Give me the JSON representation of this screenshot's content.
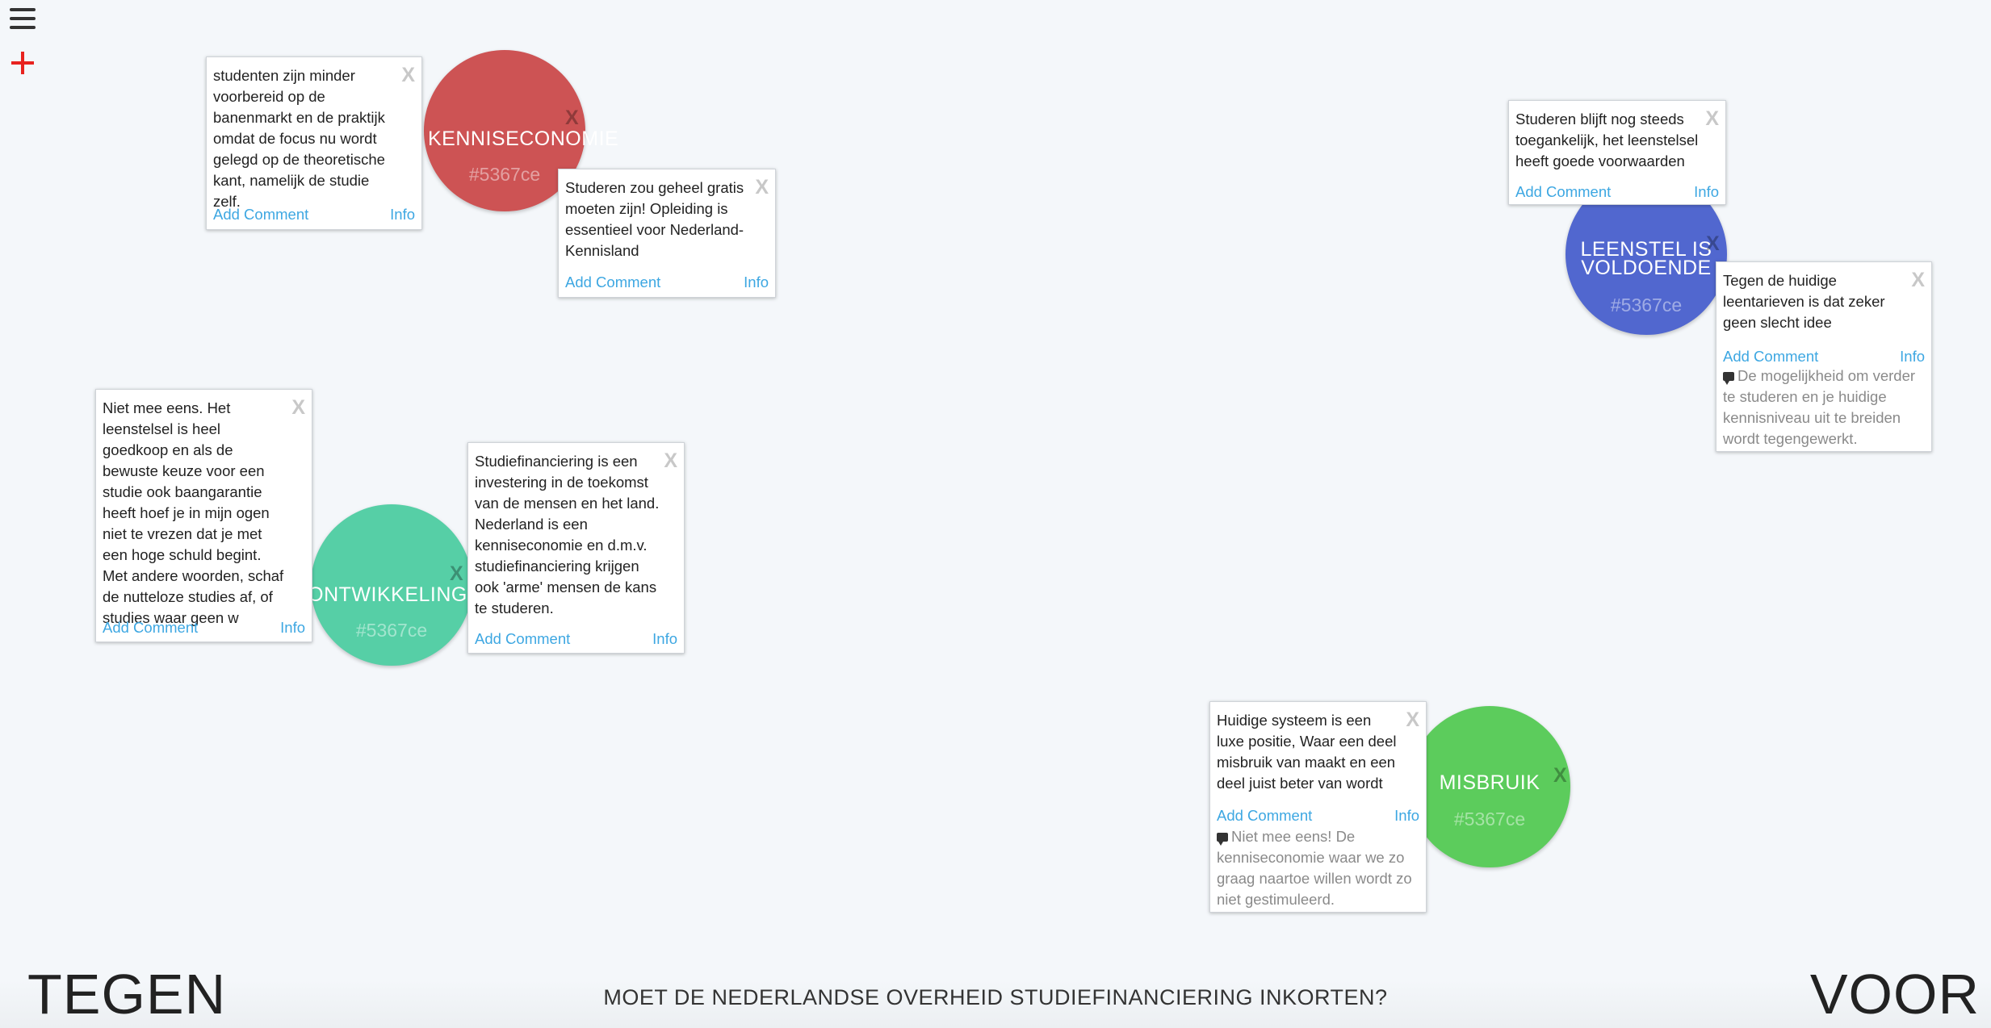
{
  "question": "MOET DE NEDERLANDSE OVERHEID STUDIEFINANCIERING INKORTEN?",
  "side_labels": {
    "left": "TEGEN",
    "right": "VOOR"
  },
  "toolbar": {
    "menu_icon": "hamburger-icon",
    "add_icon": "plus-icon"
  },
  "colors": {
    "accent": "#e8231f",
    "link": "#3da7e2",
    "kenniseconomie": "#cd5354",
    "leenstel": "#5167cf",
    "ontwikkeling": "#56cfa6",
    "misbruik": "#5ccc5c"
  },
  "nodes": [
    {
      "title": "KENNISECONOMIE",
      "code": "#5367ce",
      "close": "X"
    },
    {
      "title": "LEENSTEL IS VOLDOENDE",
      "code": "#5367ce",
      "close": "X"
    },
    {
      "title": "ONTWIKKELING",
      "code": "#5367ce",
      "close": "X"
    },
    {
      "title": "MISBRUIK",
      "code": "#5367ce",
      "close": "X"
    }
  ],
  "cards": [
    {
      "text": "studenten zijn minder voorbereid op de banenmarkt en de praktijk omdat de focus nu wordt gelegd op de theoretische kant, namelijk de studie zelf.",
      "close": "X",
      "add_comment": "Add Comment",
      "info": "Info"
    },
    {
      "text": "Studeren zou geheel gratis moeten zijn! Opleiding is essentieel voor Nederland-Kennisland",
      "close": "X",
      "add_comment": "Add Comment",
      "info": "Info"
    },
    {
      "text": "Studeren blijft nog steeds toegankelijk, het leenstelsel heeft goede voorwaarden",
      "close": "X",
      "add_comment": "Add Comment",
      "info": "Info"
    },
    {
      "text": "Tegen de huidige leentarieven is dat zeker geen slecht idee",
      "close": "X",
      "add_comment": "Add Comment",
      "info": "Info",
      "comment": "De mogelijkheid om verder te studeren en je huidige kennisniveau uit te breiden wordt tegengewerkt."
    },
    {
      "text": "Niet mee eens. Het leenstelsel is heel goedkoop en als de bewuste keuze voor een studie ook baangarantie heeft hoef je in mijn ogen niet te vrezen dat je met een hoge schuld begint. Met andere woorden, schaf de nutteloze studies af, of studies waar geen w",
      "close": "X",
      "add_comment": "Add Comment",
      "info": "Info"
    },
    {
      "text": "Studiefinanciering is een investering in de toekomst van de mensen en het land. Nederland is een kenniseconomie en d.m.v. studiefinanciering krijgen ook 'arme' mensen de kans te studeren.",
      "close": "X",
      "add_comment": "Add Comment",
      "info": "Info"
    },
    {
      "text": "Huidige systeem is een luxe positie, Waar een deel misbruik van maakt en een deel juist beter van wordt",
      "close": "X",
      "add_comment": "Add Comment",
      "info": "Info",
      "comment": "Niet mee eens! De kenniseconomie waar we zo graag naartoe willen wordt zo niet gestimuleerd."
    }
  ]
}
